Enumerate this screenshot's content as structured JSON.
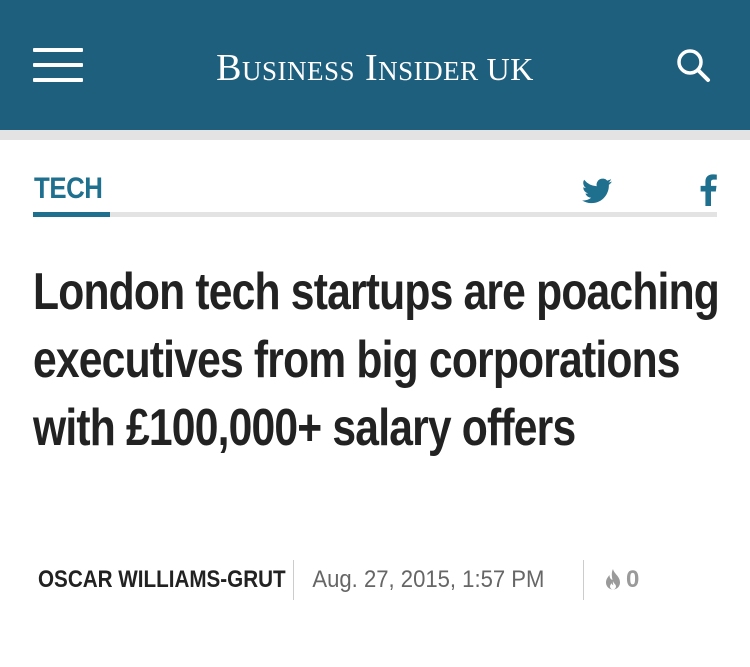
{
  "header": {
    "brand_main": "Business Insider",
    "brand_region": "UK",
    "menu_icon": "hamburger-menu-icon",
    "search_icon": "search-icon",
    "background_color": "#1f5f7e"
  },
  "article": {
    "section": "TECH",
    "section_color": "#1f6f8e",
    "share": {
      "twitter_icon": "twitter-icon",
      "facebook_icon": "facebook-icon"
    },
    "headline": "London tech startups are poaching executives from big corporations with £100,000+ salary offers",
    "author": "OSCAR WILLIAMS-GRUT",
    "published": "Aug. 27, 2015, 1:57 PM",
    "views_icon": "flame-icon",
    "views_count": "0"
  }
}
